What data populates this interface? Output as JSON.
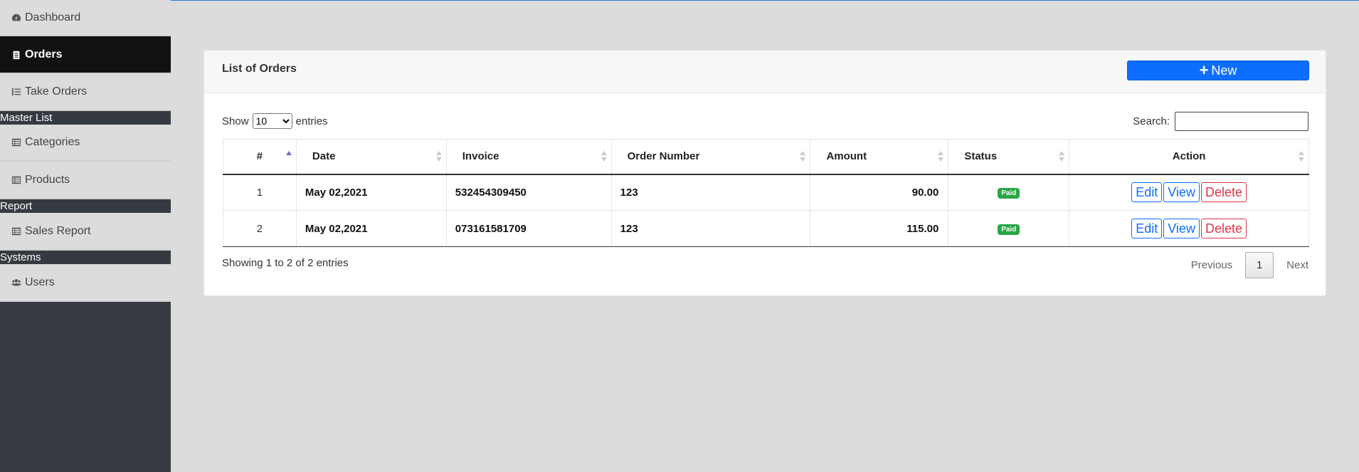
{
  "sidebar": {
    "items": [
      {
        "label": "Dashboard",
        "icon": "dashboard-icon"
      },
      {
        "label": "Orders",
        "icon": "clipboard-icon",
        "active": true
      },
      {
        "label": "Take Orders",
        "icon": "list-icon"
      }
    ],
    "sections": [
      {
        "title": "Master List",
        "items": [
          {
            "label": "Categories",
            "icon": "table-list-icon"
          },
          {
            "label": "Products",
            "icon": "table-list-icon"
          }
        ]
      },
      {
        "title": "Report",
        "items": [
          {
            "label": "Sales Report",
            "icon": "table-list-icon"
          }
        ]
      },
      {
        "title": "Systems",
        "items": [
          {
            "label": "Users",
            "icon": "users-icon"
          }
        ]
      }
    ]
  },
  "card": {
    "title": "List of Orders",
    "new_label": "New"
  },
  "controls": {
    "show_label": "Show",
    "entries_label": "entries",
    "page_size": "10",
    "search_label": "Search:"
  },
  "table": {
    "headers": [
      "#",
      "Date",
      "Invoice",
      "Order Number",
      "Amount",
      "Status",
      "Action"
    ],
    "rows": [
      {
        "num": "1",
        "date": "May 02,2021",
        "invoice": "532454309450",
        "order_number": "123",
        "amount": "90.00",
        "status": "Paid"
      },
      {
        "num": "2",
        "date": "May 02,2021",
        "invoice": "073161581709",
        "order_number": "123",
        "amount": "115.00",
        "status": "Paid"
      }
    ],
    "actions": {
      "edit": "Edit",
      "view": "View",
      "delete": "Delete"
    }
  },
  "footer": {
    "info": "Showing 1 to 2 of 2 entries",
    "previous": "Previous",
    "page": "1",
    "next": "Next"
  },
  "colors": {
    "primary": "#0d6efd",
    "danger": "#dc3545",
    "success": "#28a745",
    "sidebar_dark": "#343a40"
  }
}
